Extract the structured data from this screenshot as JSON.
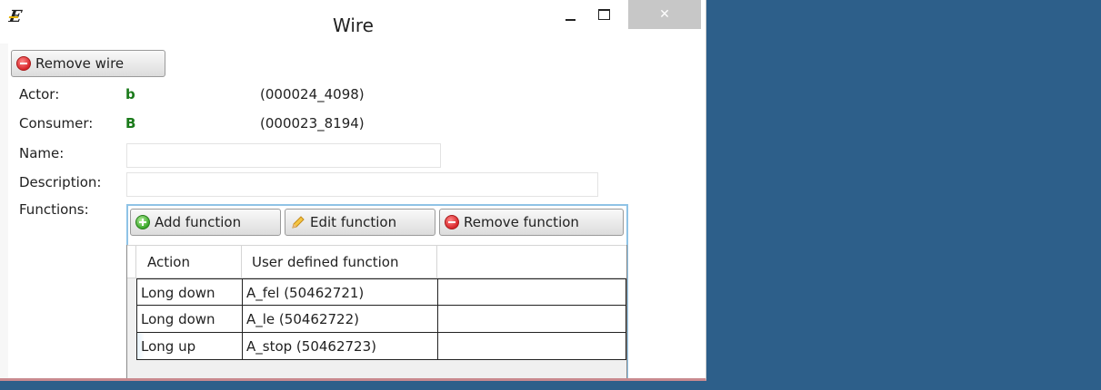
{
  "window": {
    "title": "Wire"
  },
  "toolbar": {
    "remove_wire_label": "Remove wire"
  },
  "fields": {
    "actor": {
      "label": "Actor:",
      "name": "b",
      "id": "(000024_4098)"
    },
    "consumer": {
      "label": "Consumer:",
      "name": "B",
      "id": "(000023_8194)"
    },
    "name": {
      "label": "Name:",
      "value": ""
    },
    "description": {
      "label": "Description:",
      "value": ""
    },
    "functions_label": "Functions:"
  },
  "functions_toolbar": {
    "add_label": "Add function",
    "edit_label": "Edit function",
    "remove_label": "Remove function"
  },
  "table": {
    "columns": [
      "Action",
      "User defined function"
    ],
    "rows": [
      {
        "action": "Long down",
        "function": "A_fel (50462721)"
      },
      {
        "action": "Long down",
        "function": "A_le (50462722)"
      },
      {
        "action": "Long up",
        "function": "A_stop (50462723)"
      }
    ]
  },
  "colors": {
    "desktop": "#2d5f8a",
    "name_green": "#1a7a1a",
    "panel_border": "#8fc3e6"
  },
  "icons": {
    "app": "app-logo-icon",
    "remove": "remove-circle-icon",
    "add": "add-circle-icon",
    "edit": "pencil-icon"
  }
}
